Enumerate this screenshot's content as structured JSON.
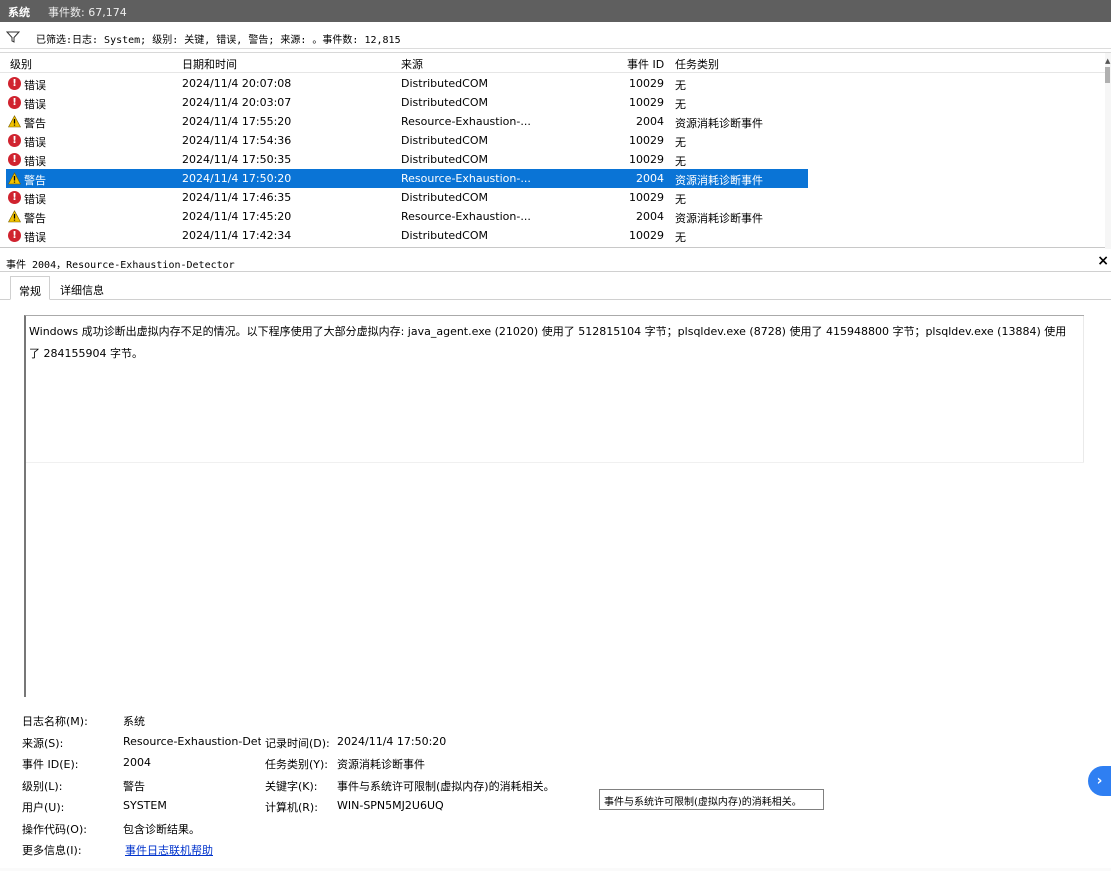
{
  "titlebar": {
    "name": "系统",
    "count": "事件数: 67,174"
  },
  "filter": {
    "text": "已筛选:日志: System; 级别: 关键, 错误, 警告; 来源: 。事件数: 12,815"
  },
  "columns": [
    "级别",
    "日期和时间",
    "来源",
    "事件 ID",
    "任务类别"
  ],
  "rows": [
    {
      "level": "错误",
      "type": "error",
      "datetime": "2024/11/4 20:07:08",
      "source": "DistributedCOM",
      "event_id": "10029",
      "category": "无"
    },
    {
      "level": "错误",
      "type": "error",
      "datetime": "2024/11/4 20:03:07",
      "source": "DistributedCOM",
      "event_id": "10029",
      "category": "无"
    },
    {
      "level": "警告",
      "type": "warning",
      "datetime": "2024/11/4 17:55:20",
      "source": "Resource-Exhaustion-...",
      "event_id": "2004",
      "category": "资源消耗诊断事件"
    },
    {
      "level": "错误",
      "type": "error",
      "datetime": "2024/11/4 17:54:36",
      "source": "DistributedCOM",
      "event_id": "10029",
      "category": "无"
    },
    {
      "level": "错误",
      "type": "error",
      "datetime": "2024/11/4 17:50:35",
      "source": "DistributedCOM",
      "event_id": "10029",
      "category": "无"
    },
    {
      "level": "警告",
      "type": "warning",
      "datetime": "2024/11/4 17:50:20",
      "source": "Resource-Exhaustion-...",
      "event_id": "2004",
      "category": "资源消耗诊断事件",
      "selected": true
    },
    {
      "level": "错误",
      "type": "error",
      "datetime": "2024/11/4 17:46:35",
      "source": "DistributedCOM",
      "event_id": "10029",
      "category": "无"
    },
    {
      "level": "警告",
      "type": "warning",
      "datetime": "2024/11/4 17:45:20",
      "source": "Resource-Exhaustion-...",
      "event_id": "2004",
      "category": "资源消耗诊断事件"
    },
    {
      "level": "错误",
      "type": "error",
      "datetime": "2024/11/4 17:42:34",
      "source": "DistributedCOM",
      "event_id": "10029",
      "category": "无"
    }
  ],
  "detail": {
    "header": "事件 2004，Resource-Exhaustion-Detector",
    "close": "×",
    "tabs": [
      "常规",
      "详细信息"
    ],
    "message": "Windows 成功诊断出虚拟内存不足的情况。以下程序使用了大部分虚拟内存: java_agent.exe (21020) 使用了 512815104 字节；plsqldev.exe (8728) 使用了 415948800 字节；plsqldev.exe (13884) 使用了 284155904 字节。",
    "props": {
      "log_name_label": "日志名称(M):",
      "log_name": "系统",
      "source_label": "来源(S):",
      "source": "Resource-Exhaustion-Dete",
      "logged_label": "记录时间(D):",
      "logged": "2024/11/4 17:50:20",
      "event_id_label": "事件 ID(E):",
      "event_id": "2004",
      "task_label": "任务类别(Y):",
      "task": "资源消耗诊断事件",
      "level_label": "级别(L):",
      "level": "警告",
      "keywords_label": "关键字(K):",
      "keywords": "事件与系统许可限制(虚拟内存)的消耗相关。",
      "user_label": "用户(U):",
      "user": "SYSTEM",
      "computer_label": "计算机(R):",
      "computer": "WIN-SPN5MJ2U6UQ",
      "opcode_label": "操作代码(O):",
      "opcode": "包含诊断结果。",
      "more_label": "更多信息(I):",
      "more_link": "事件日志联机帮助"
    },
    "tooltip": "事件与系统许可限制(虚拟内存)的消耗相关。"
  },
  "side_button": "›",
  "colors": {
    "selection": "#0a74d6",
    "error": "#d0232f",
    "warning": "#f2c200",
    "link": "#0033cc"
  }
}
